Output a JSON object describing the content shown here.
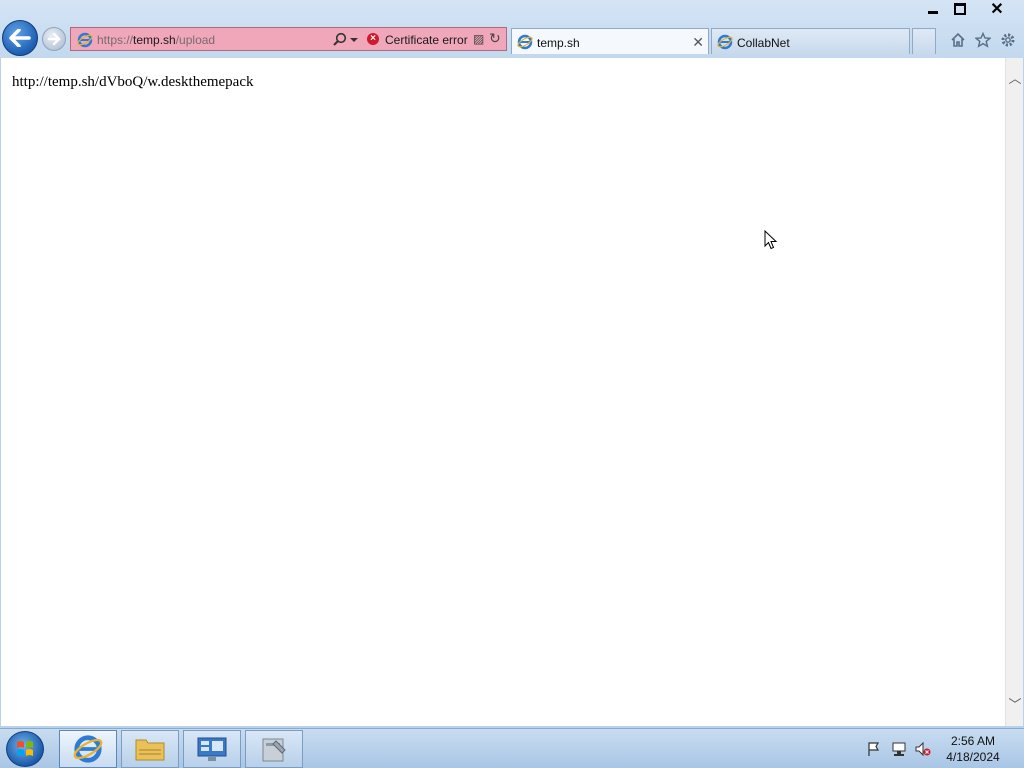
{
  "browser": {
    "address": {
      "url_scheme": "https://",
      "url_host": "temp.sh",
      "url_path": "/upload",
      "certificate_label": "Certificate error"
    },
    "tabs": [
      {
        "label": "temp.sh",
        "active": true
      },
      {
        "label": "CollabNet",
        "active": false
      }
    ],
    "window_controls": {
      "close_label": "✕"
    }
  },
  "page": {
    "text": "http://temp.sh/dVboQ/w.deskthemepack"
  },
  "taskbar": {
    "clock_time": "2:56 AM",
    "clock_date": "4/18/2024"
  },
  "colors": {
    "address_error": "#f0a7ba",
    "chrome": "#c3d8ee",
    "taskbar": "#b9d1ea"
  },
  "icons": [
    "back-arrow-icon",
    "forward-arrow-icon",
    "ie-icon",
    "search-icon",
    "certificate-error-icon",
    "compat-view-icon",
    "refresh-icon",
    "home-icon",
    "favorites-star-icon",
    "settings-gear-icon",
    "windows-start-icon",
    "folder-icon",
    "server-manager-icon",
    "admin-tools-icon",
    "action-center-flag-icon",
    "network-icon",
    "volume-muted-icon"
  ]
}
